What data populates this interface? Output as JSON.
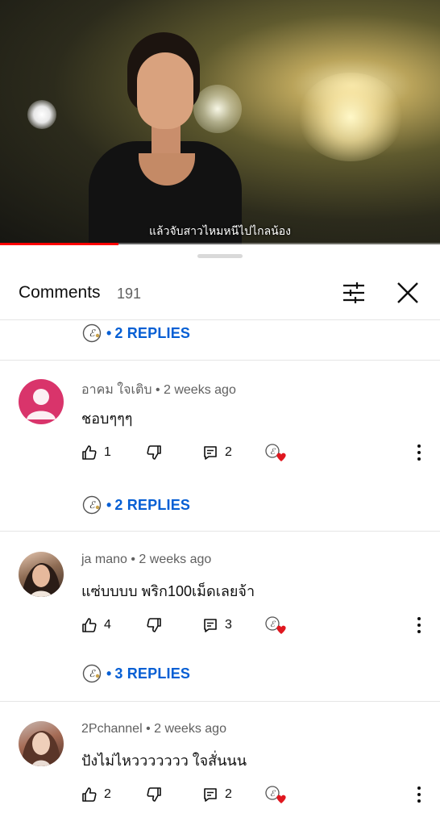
{
  "video": {
    "caption": "แล้วจับสาวไหมหนีไปไกลน้อง",
    "progress_fraction": 0.27
  },
  "sheet": {
    "title": "Comments",
    "count": "191",
    "icons": {
      "filter": "sliders-icon",
      "close": "close-icon"
    }
  },
  "threads": [
    {
      "replies_label": "2 REPLIES"
    },
    {
      "author": "อาคม ใจเติบ",
      "time": "2 weeks ago",
      "text": "ชอบๆๆๆ",
      "likes": "1",
      "reply_count": "2",
      "replies_label": "2 REPLIES"
    },
    {
      "author": "ja mano",
      "time": "2 weeks ago",
      "text": "แซ่บบบบ  พริก100เม็ดเลยจ้า",
      "likes": "4",
      "reply_count": "3",
      "replies_label": "3 REPLIES"
    },
    {
      "author": "2Pchannel",
      "time": "2 weeks ago",
      "text": "ปังไม่ไหววววววว ใจสั่นนน",
      "likes": "2",
      "reply_count": "2"
    }
  ],
  "colors": {
    "accent_link": "#065fd4",
    "heart": "#e0171f",
    "progress": "#ff0000"
  }
}
